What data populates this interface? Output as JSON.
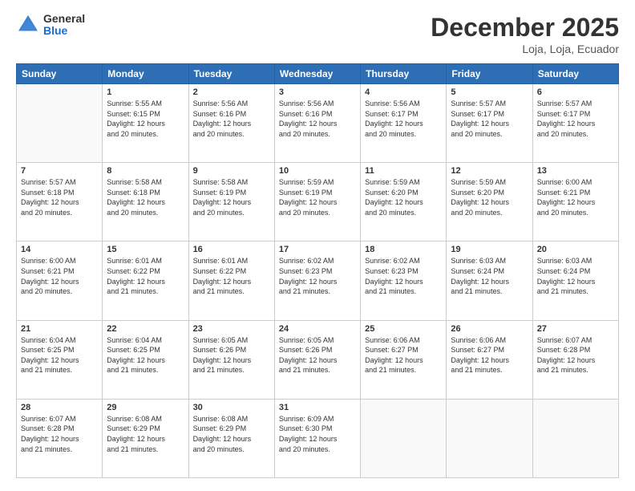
{
  "logo": {
    "general": "General",
    "blue": "Blue"
  },
  "header": {
    "month": "December 2025",
    "location": "Loja, Loja, Ecuador"
  },
  "weekdays": [
    "Sunday",
    "Monday",
    "Tuesday",
    "Wednesday",
    "Thursday",
    "Friday",
    "Saturday"
  ],
  "weeks": [
    [
      {
        "day": "",
        "info": ""
      },
      {
        "day": "1",
        "info": "Sunrise: 5:55 AM\nSunset: 6:15 PM\nDaylight: 12 hours\nand 20 minutes."
      },
      {
        "day": "2",
        "info": "Sunrise: 5:56 AM\nSunset: 6:16 PM\nDaylight: 12 hours\nand 20 minutes."
      },
      {
        "day": "3",
        "info": "Sunrise: 5:56 AM\nSunset: 6:16 PM\nDaylight: 12 hours\nand 20 minutes."
      },
      {
        "day": "4",
        "info": "Sunrise: 5:56 AM\nSunset: 6:17 PM\nDaylight: 12 hours\nand 20 minutes."
      },
      {
        "day": "5",
        "info": "Sunrise: 5:57 AM\nSunset: 6:17 PM\nDaylight: 12 hours\nand 20 minutes."
      },
      {
        "day": "6",
        "info": "Sunrise: 5:57 AM\nSunset: 6:17 PM\nDaylight: 12 hours\nand 20 minutes."
      }
    ],
    [
      {
        "day": "7",
        "info": "Sunrise: 5:57 AM\nSunset: 6:18 PM\nDaylight: 12 hours\nand 20 minutes."
      },
      {
        "day": "8",
        "info": "Sunrise: 5:58 AM\nSunset: 6:18 PM\nDaylight: 12 hours\nand 20 minutes."
      },
      {
        "day": "9",
        "info": "Sunrise: 5:58 AM\nSunset: 6:19 PM\nDaylight: 12 hours\nand 20 minutes."
      },
      {
        "day": "10",
        "info": "Sunrise: 5:59 AM\nSunset: 6:19 PM\nDaylight: 12 hours\nand 20 minutes."
      },
      {
        "day": "11",
        "info": "Sunrise: 5:59 AM\nSunset: 6:20 PM\nDaylight: 12 hours\nand 20 minutes."
      },
      {
        "day": "12",
        "info": "Sunrise: 5:59 AM\nSunset: 6:20 PM\nDaylight: 12 hours\nand 20 minutes."
      },
      {
        "day": "13",
        "info": "Sunrise: 6:00 AM\nSunset: 6:21 PM\nDaylight: 12 hours\nand 20 minutes."
      }
    ],
    [
      {
        "day": "14",
        "info": "Sunrise: 6:00 AM\nSunset: 6:21 PM\nDaylight: 12 hours\nand 20 minutes."
      },
      {
        "day": "15",
        "info": "Sunrise: 6:01 AM\nSunset: 6:22 PM\nDaylight: 12 hours\nand 21 minutes."
      },
      {
        "day": "16",
        "info": "Sunrise: 6:01 AM\nSunset: 6:22 PM\nDaylight: 12 hours\nand 21 minutes."
      },
      {
        "day": "17",
        "info": "Sunrise: 6:02 AM\nSunset: 6:23 PM\nDaylight: 12 hours\nand 21 minutes."
      },
      {
        "day": "18",
        "info": "Sunrise: 6:02 AM\nSunset: 6:23 PM\nDaylight: 12 hours\nand 21 minutes."
      },
      {
        "day": "19",
        "info": "Sunrise: 6:03 AM\nSunset: 6:24 PM\nDaylight: 12 hours\nand 21 minutes."
      },
      {
        "day": "20",
        "info": "Sunrise: 6:03 AM\nSunset: 6:24 PM\nDaylight: 12 hours\nand 21 minutes."
      }
    ],
    [
      {
        "day": "21",
        "info": "Sunrise: 6:04 AM\nSunset: 6:25 PM\nDaylight: 12 hours\nand 21 minutes."
      },
      {
        "day": "22",
        "info": "Sunrise: 6:04 AM\nSunset: 6:25 PM\nDaylight: 12 hours\nand 21 minutes."
      },
      {
        "day": "23",
        "info": "Sunrise: 6:05 AM\nSunset: 6:26 PM\nDaylight: 12 hours\nand 21 minutes."
      },
      {
        "day": "24",
        "info": "Sunrise: 6:05 AM\nSunset: 6:26 PM\nDaylight: 12 hours\nand 21 minutes."
      },
      {
        "day": "25",
        "info": "Sunrise: 6:06 AM\nSunset: 6:27 PM\nDaylight: 12 hours\nand 21 minutes."
      },
      {
        "day": "26",
        "info": "Sunrise: 6:06 AM\nSunset: 6:27 PM\nDaylight: 12 hours\nand 21 minutes."
      },
      {
        "day": "27",
        "info": "Sunrise: 6:07 AM\nSunset: 6:28 PM\nDaylight: 12 hours\nand 21 minutes."
      }
    ],
    [
      {
        "day": "28",
        "info": "Sunrise: 6:07 AM\nSunset: 6:28 PM\nDaylight: 12 hours\nand 21 minutes."
      },
      {
        "day": "29",
        "info": "Sunrise: 6:08 AM\nSunset: 6:29 PM\nDaylight: 12 hours\nand 21 minutes."
      },
      {
        "day": "30",
        "info": "Sunrise: 6:08 AM\nSunset: 6:29 PM\nDaylight: 12 hours\nand 20 minutes."
      },
      {
        "day": "31",
        "info": "Sunrise: 6:09 AM\nSunset: 6:30 PM\nDaylight: 12 hours\nand 20 minutes."
      },
      {
        "day": "",
        "info": ""
      },
      {
        "day": "",
        "info": ""
      },
      {
        "day": "",
        "info": ""
      }
    ]
  ]
}
